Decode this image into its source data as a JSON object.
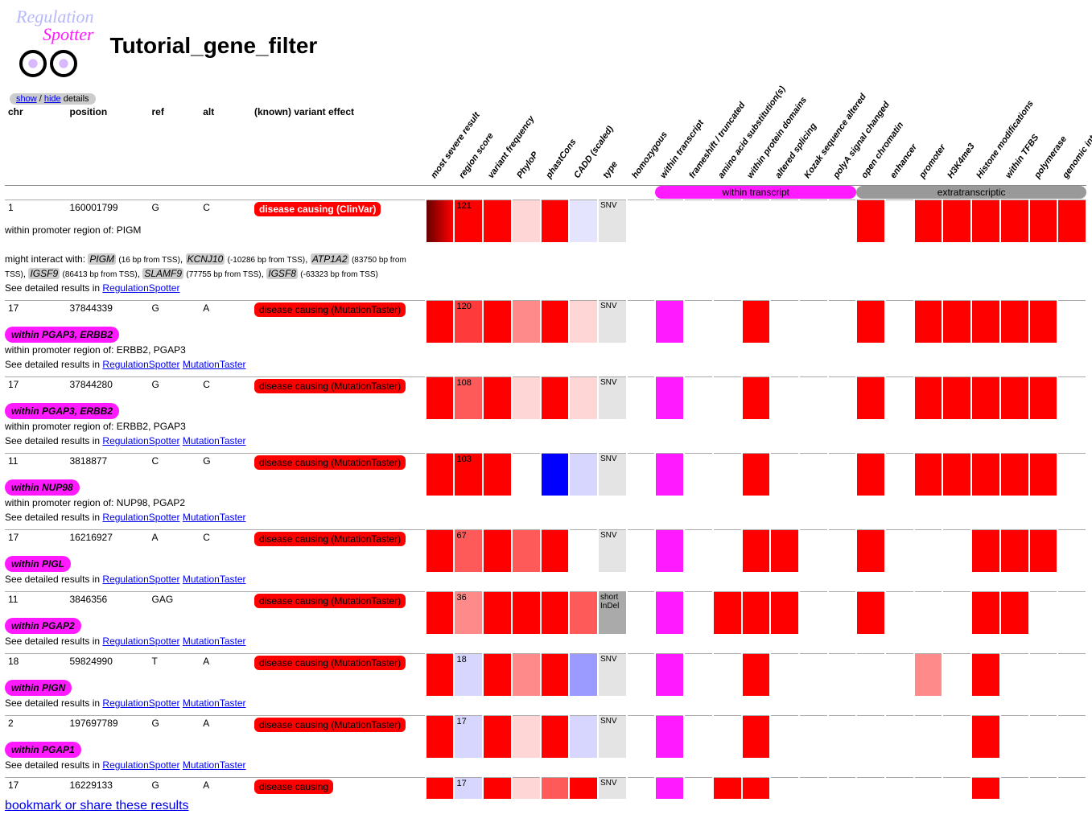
{
  "app_title": "Tutorial_gene_filter",
  "logo": {
    "reg": "Regulation",
    "spot": "Spotter"
  },
  "details_toggle": {
    "show": "show",
    "hide": "hide",
    "suffix": " details"
  },
  "footer_link": "bookmark or share these results",
  "columns_left": [
    "chr",
    "position",
    "ref",
    "alt",
    "(known) variant effect"
  ],
  "columns_rot": [
    "most severe result",
    "region score",
    "variant frequency",
    "PhyloP",
    "phastCons",
    "CADD (scaled)",
    "type",
    "homozygous",
    "within transcript",
    "frameshift / truncated",
    "amino acid substitution(s)",
    "within protein domains",
    "altered splicing",
    "Kozak sequence altered",
    "polyA signal changed",
    "open chromatin",
    "enhancer",
    "promoter",
    "H3K4me3",
    "Histone modifications",
    "within TFBS",
    "polymerase",
    "genomic interaction(s)"
  ],
  "group_labels": {
    "transcript": "within transcript",
    "extra": "extratranscriptic"
  },
  "link_labels": {
    "rs": "RegulationSpotter",
    "mt": "MutationTaster",
    "see": "See detailed results in "
  },
  "variants": [
    {
      "chr": "1",
      "pos": "160001799",
      "ref": "G",
      "alt": "C",
      "effect": "disease causing (ClinVar)",
      "effect_white": true,
      "score": "121",
      "detail_html": "within promoter region of: PIGM<br><br>might interact with: <span class='gene-badge'>PIGM</span> <span class='small'>(16 bp from TSS)</span>, <span class='gene-badge'>KCNJ10</span> <span class='small'>(-10286 bp from TSS)</span>, <span class='gene-badge'>ATP1A2</span> <span class='small'>(83750 bp from TSS)</span>, <span class='gene-badge'>IGSF9</span> <span class='small'>(86413 bp from TSS)</span>, <span class='gene-badge'>SLAMF9</span> <span class='small'>(77755 bp from TSS)</span>, <span class='gene-badge'>IGSF8</span> <span class='small'>(-63323 bp from TSS)</span>",
      "has_mt": false,
      "cells": [
        "gradred",
        "red",
        "red",
        "#ffd6d6",
        "red",
        "#e4e4ff",
        "#e4e4e4",
        "none",
        "none",
        "none",
        "none",
        "none",
        "none",
        "none",
        "none",
        "red",
        "none",
        "red",
        "red",
        "red",
        "red",
        "red",
        "red"
      ],
      "type": "SNV"
    },
    {
      "chr": "17",
      "pos": "37844339",
      "ref": "G",
      "alt": "A",
      "effect": "disease causing (MutationTaster)",
      "score": "120",
      "within": "within PGAP3, ERBB2",
      "detail_html": "within promoter region of: ERBB2, PGAP3",
      "has_mt": true,
      "cells": [
        "red",
        "#ff3a3a",
        "red",
        "#ff8a8a",
        "red",
        "#ffd6d6",
        "#e4e4e4",
        "none",
        "#ff1aff",
        "none",
        "none",
        "red",
        "none",
        "none",
        "none",
        "red",
        "none",
        "red",
        "red",
        "red",
        "red",
        "red",
        "none"
      ],
      "type": "SNV"
    },
    {
      "chr": "17",
      "pos": "37844280",
      "ref": "G",
      "alt": "C",
      "effect": "disease causing (MutationTaster)",
      "score": "108",
      "within": "within PGAP3, ERBB2",
      "detail_html": "within promoter region of: ERBB2, PGAP3",
      "has_mt": true,
      "cells": [
        "red",
        "#ff5a5a",
        "red",
        "#ffd6d6",
        "red",
        "#ffd6d6",
        "#e4e4e4",
        "none",
        "#ff1aff",
        "none",
        "none",
        "red",
        "none",
        "none",
        "none",
        "red",
        "none",
        "red",
        "red",
        "red",
        "red",
        "red",
        "none"
      ],
      "type": "SNV"
    },
    {
      "chr": "11",
      "pos": "3818877",
      "ref": "C",
      "alt": "G",
      "effect": "disease causing (MutationTaster)",
      "score": "103",
      "within": "within NUP98",
      "detail_html": "within promoter region of: NUP98, PGAP2",
      "has_mt": true,
      "cells": [
        "red",
        "red",
        "red",
        "none",
        "#0000ff",
        "#d6d6ff",
        "#e4e4e4",
        "none",
        "#ff1aff",
        "none",
        "none",
        "red",
        "none",
        "none",
        "none",
        "red",
        "none",
        "red",
        "red",
        "red",
        "red",
        "red",
        "none"
      ],
      "type": "SNV"
    },
    {
      "chr": "17",
      "pos": "16216927",
      "ref": "A",
      "alt": "C",
      "effect": "disease causing (MutationTaster)",
      "score": "67",
      "within": "within PIGL",
      "detail_html": "",
      "has_mt": true,
      "cells": [
        "red",
        "#ff5a5a",
        "red",
        "#ff5a5a",
        "red",
        "none",
        "#e4e4e4",
        "none",
        "#ff1aff",
        "none",
        "none",
        "red",
        "red",
        "none",
        "none",
        "red",
        "none",
        "none",
        "none",
        "red",
        "red",
        "red",
        "none"
      ],
      "type": "SNV"
    },
    {
      "chr": "11",
      "pos": "3846356",
      "ref": "GAG",
      "alt": "",
      "effect": "disease causing (MutationTaster)",
      "score": "36",
      "within": "within PGAP2",
      "detail_html": "",
      "has_mt": true,
      "cells": [
        "red",
        "#ff8a8a",
        "red",
        "red",
        "red",
        "#ff5a5a",
        "#aaa",
        "none",
        "#ff1aff",
        "none",
        "red",
        "red",
        "red",
        "none",
        "none",
        "red",
        "none",
        "none",
        "none",
        "red",
        "red",
        "none",
        "none"
      ],
      "type": "short InDel"
    },
    {
      "chr": "18",
      "pos": "59824990",
      "ref": "T",
      "alt": "A",
      "effect": "disease causing (MutationTaster)",
      "score": "18",
      "within": "within PIGN",
      "detail_html": "",
      "has_mt": true,
      "cells": [
        "red",
        "#d6d6ff",
        "red",
        "#ff8a8a",
        "red",
        "#9a9aff",
        "#e4e4e4",
        "none",
        "#ff1aff",
        "none",
        "none",
        "red",
        "none",
        "none",
        "none",
        "none",
        "none",
        "#ff8a8a",
        "none",
        "red",
        "none",
        "none",
        "none"
      ],
      "type": "SNV"
    },
    {
      "chr": "2",
      "pos": "197697789",
      "ref": "G",
      "alt": "A",
      "effect": "disease causing (MutationTaster)",
      "score": "17",
      "within": "within PGAP1",
      "detail_html": "",
      "has_mt": true,
      "cells": [
        "red",
        "#d6d6ff",
        "red",
        "#ffd6d6",
        "red",
        "#d6d6ff",
        "#e4e4e4",
        "none",
        "#ff1aff",
        "none",
        "none",
        "red",
        "none",
        "none",
        "none",
        "none",
        "none",
        "none",
        "none",
        "red",
        "none",
        "none",
        "none"
      ],
      "type": "SNV"
    },
    {
      "chr": "17",
      "pos": "16229133",
      "ref": "G",
      "alt": "A",
      "effect": "disease causing",
      "score": "17",
      "cells": [
        "red",
        "#d6d6ff",
        "red",
        "#ffd6d6",
        "#ff5a5a",
        "red",
        "#e4e4e4",
        "none",
        "#ff1aff",
        "none",
        "red",
        "red",
        "none",
        "none",
        "none",
        "none",
        "none",
        "none",
        "none",
        "red",
        "none",
        "none",
        "none"
      ],
      "type": "SNV"
    }
  ]
}
